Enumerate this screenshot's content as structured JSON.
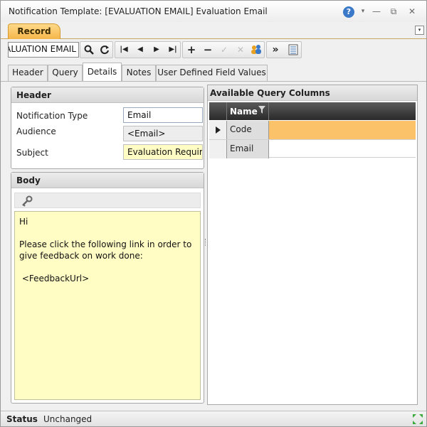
{
  "window": {
    "title": "Notification Template: [EVALUATION EMAIL] Evaluation Email",
    "help_icon": "?",
    "dropdown_icon": "▾",
    "minimize_icon": "—",
    "restore_icon": "⧉",
    "close_icon": "✕"
  },
  "ribbon": {
    "tabs": [
      {
        "label": "Record"
      }
    ],
    "collapse_icon": "▾"
  },
  "toolbar": {
    "search_value": "EVALUATION EMAIL",
    "icons": {
      "search": "search-icon",
      "refresh": "refresh-icon",
      "first": "first-record-icon",
      "prev": "previous-record-icon",
      "next": "next-record-icon",
      "last": "last-record-icon",
      "add": "add-icon",
      "delete": "delete-icon",
      "save": "save-check-icon",
      "cancel": "cancel-icon",
      "users": "users-icon",
      "more": "more-icon",
      "notes": "notes-icon"
    }
  },
  "tabs": [
    {
      "label": "Header"
    },
    {
      "label": "Query"
    },
    {
      "label": "Details"
    },
    {
      "label": "Notes"
    },
    {
      "label": "User Defined Field Values"
    }
  ],
  "active_tab": "Details",
  "header_panel": {
    "title": "Header",
    "fields": [
      {
        "label": "Notification Type",
        "value": "Email"
      },
      {
        "label": "Audience",
        "value": "<Email>"
      },
      {
        "label": "Subject",
        "value": "Evaluation Required"
      }
    ]
  },
  "body_panel": {
    "title": "Body",
    "text": "Hi\n\nPlease click the following link in order to give feedback on work done:\n\n <FeedbackUrl>"
  },
  "query_columns": {
    "title": "Available Query Columns",
    "column_header": "Name",
    "rows": [
      {
        "name": "Code",
        "selected": true
      },
      {
        "name": "Email",
        "selected": false
      }
    ]
  },
  "status": {
    "label": "Status",
    "value": "Unchanged"
  },
  "colors": {
    "accent": "#f5b64a",
    "selected_row": "#fbc26a",
    "body_background": "#fffdc4"
  }
}
